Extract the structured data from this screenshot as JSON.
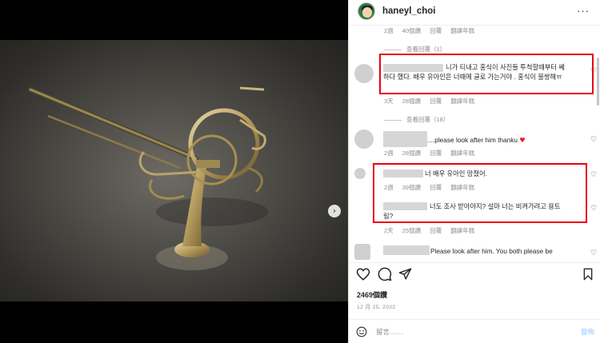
{
  "header": {
    "username": "haneyl_choi",
    "more_icon": "more-icon"
  },
  "media": {
    "next_icon": "chevron-right-icon",
    "carousel_dots": 6,
    "active_dot": 0
  },
  "comments": [
    {
      "meta": {
        "time": "2週",
        "likes": "40個讚",
        "reply": "回覆",
        "translate": "翻譯年糕"
      }
    },
    {
      "view_replies": "查看回覆（1）"
    },
    {
      "text": "니가 티내고 홍식이 사진들 투척할때부터 쎄하다 했다. 배우 유아인은 너때메 글로 가는거야 . 홍식이 불쌍해ㅠ",
      "meta": {
        "time": "3天",
        "likes": "28個讚",
        "reply": "回覆",
        "translate": "翻譯年糕"
      }
    },
    {
      "view_replies": "查看回覆（18）"
    },
    {
      "text": "....please look after him thanku",
      "meta": {
        "time": "2週",
        "likes": "28個讚",
        "reply": "回覆",
        "translate": "翻譯年糕"
      }
    },
    {
      "text": "너 배우 유아인 망쳤어.",
      "meta": {
        "time": "2週",
        "likes": "39個讚",
        "reply": "回覆",
        "translate": "翻譯年糕"
      }
    },
    {
      "text": "너도 조사 받아야지? 설마 너는 비켜가려고 용트림?",
      "meta": {
        "time": "2天",
        "likes": "25個讚",
        "reply": "回覆",
        "translate": "翻譯年糕"
      }
    },
    {
      "text": "Please look after him. You both please be"
    }
  ],
  "actions": {
    "like_icon": "heart-icon",
    "comment_icon": "comment-icon",
    "share_icon": "share-icon",
    "save_icon": "bookmark-icon"
  },
  "likes": "2469個讚",
  "date": "12 月 25, 2022",
  "add_comment": {
    "placeholder": "留言……",
    "post_label": "發佈",
    "emoji_icon": "emoji-icon"
  },
  "colors": {
    "highlight_box": "#e60012",
    "heart_red": "#ed1c24",
    "post_button": "#b3dbff"
  }
}
